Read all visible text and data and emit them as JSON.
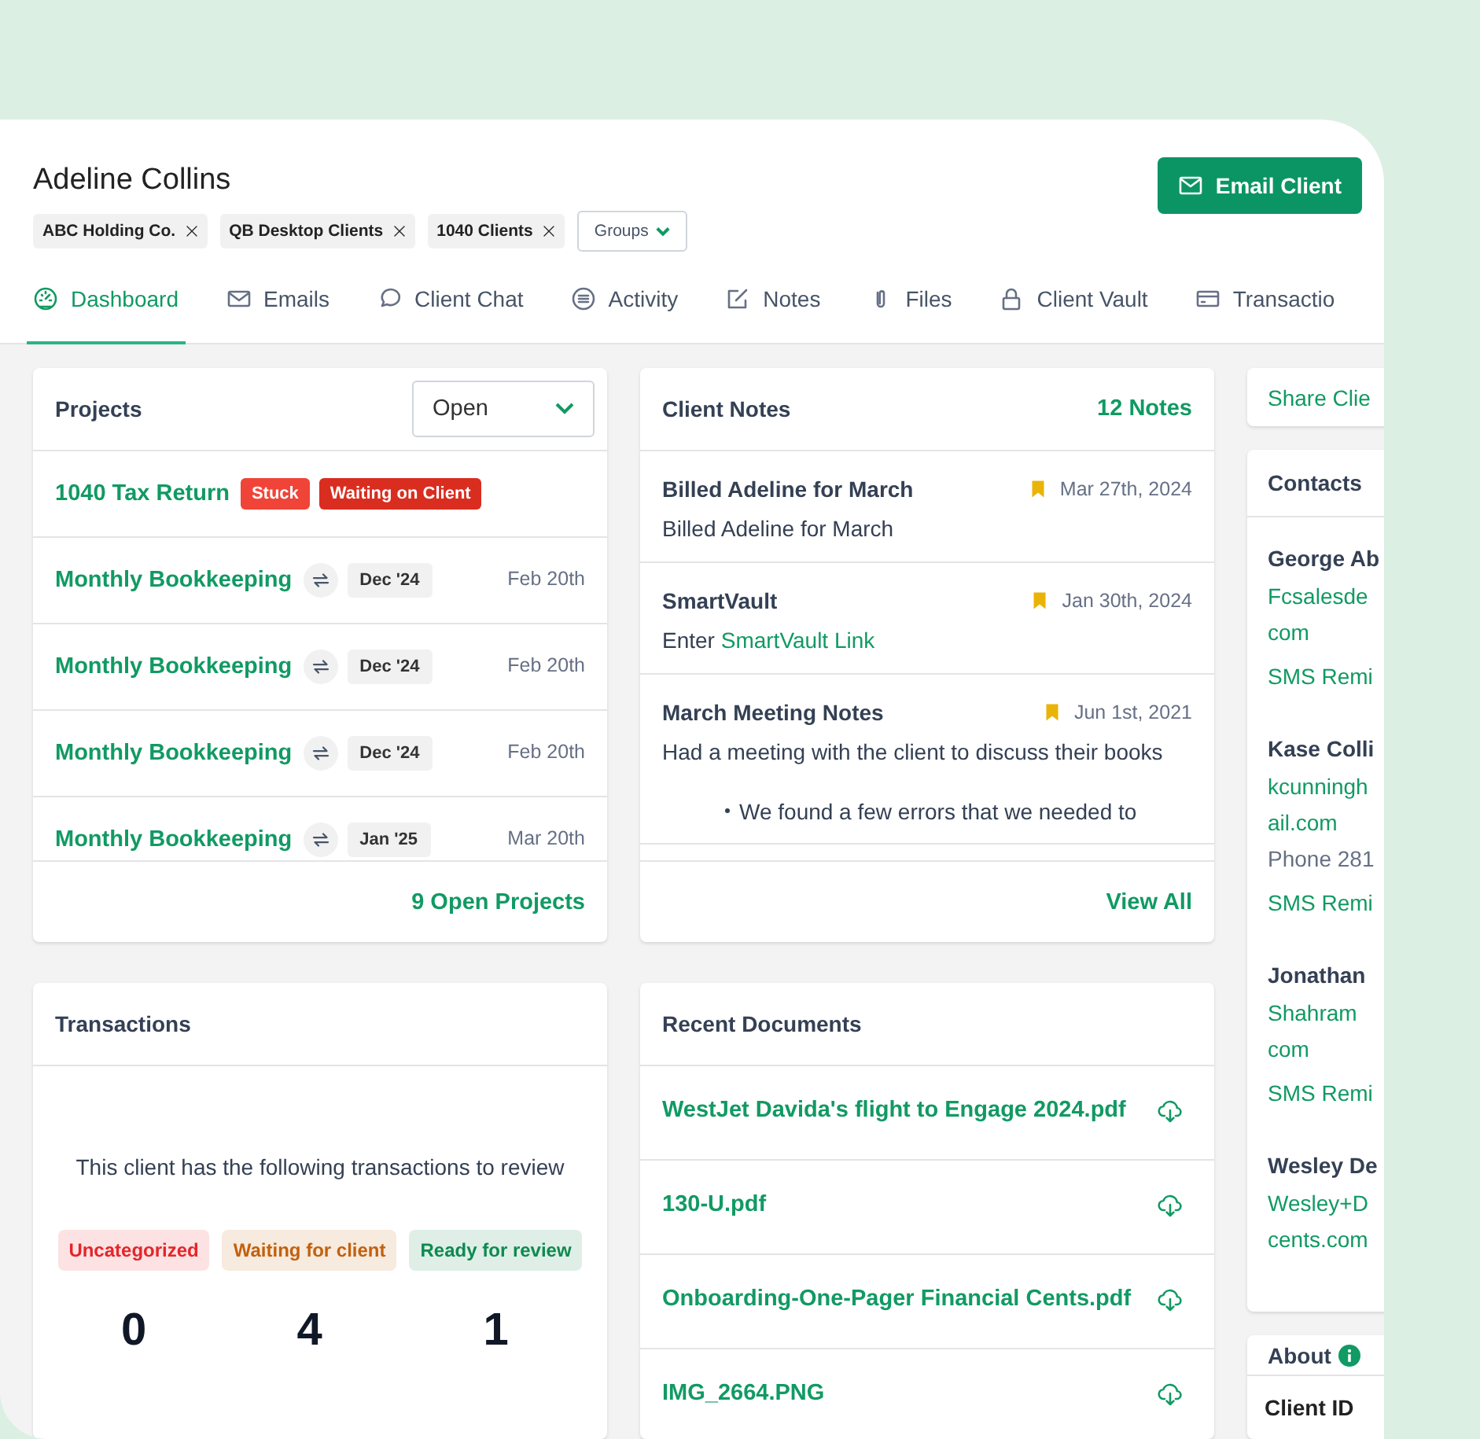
{
  "client": {
    "name": "Adeline Collins",
    "groups": [
      {
        "label": "ABC Holding Co."
      },
      {
        "label": "QB Desktop Clients"
      },
      {
        "label": "1040 Clients"
      }
    ],
    "groups_button": "Groups",
    "email_button": "Email Client"
  },
  "tabs": [
    {
      "label": "Dashboard",
      "selected": true
    },
    {
      "label": "Emails",
      "selected": false
    },
    {
      "label": "Client Chat",
      "selected": false
    },
    {
      "label": "Activity",
      "selected": false
    },
    {
      "label": "Notes",
      "selected": false
    },
    {
      "label": "Files",
      "selected": false
    },
    {
      "label": "Client Vault",
      "selected": false
    },
    {
      "label": "Transactio",
      "selected": false
    }
  ],
  "projects": {
    "title": "Projects",
    "filter": "Open",
    "rows": [
      {
        "kind": "tagged",
        "name": "1040 Tax Return",
        "tags": [
          {
            "label": "Stuck",
            "color": "#f04438"
          },
          {
            "label": "Waiting on Client",
            "color": "#d92d20"
          }
        ]
      },
      {
        "kind": "recurring",
        "name": "Monthly Bookkeeping",
        "period": "Dec '24",
        "date": "Feb 20th"
      },
      {
        "kind": "recurring",
        "name": "Monthly Bookkeeping",
        "period": "Dec '24",
        "date": "Feb 20th"
      },
      {
        "kind": "recurring",
        "name": "Monthly Bookkeeping",
        "period": "Dec '24",
        "date": "Feb 20th"
      },
      {
        "kind": "recurring",
        "name": "Monthly Bookkeeping",
        "period": "Jan '25",
        "date": "Mar 20th"
      }
    ],
    "footer": "9 Open Projects"
  },
  "client_notes": {
    "title": "Client Notes",
    "count": "12 Notes",
    "notes": [
      {
        "title": "Billed Adeline for March",
        "date": "Mar 27th, 2024",
        "body": "Billed Adeline for March"
      },
      {
        "title": "SmartVault",
        "date": "Jan 30th, 2024",
        "body": "Enter",
        "link": "SmartVault Link"
      },
      {
        "title": "March Meeting Notes",
        "date": "Jun 1st, 2021",
        "body": "Had a meeting with the client to discuss their books",
        "bullets": [
          "We found a few errors that we needed to"
        ]
      }
    ],
    "footer": "View All"
  },
  "transactions": {
    "title": "Transactions",
    "message": "This client has the following transactions to review",
    "statuses": [
      {
        "label": "Uncategorized",
        "count": "0",
        "color": "#e5252a"
      },
      {
        "label": "Waiting for client",
        "count": "4",
        "color": "#c2610c"
      },
      {
        "label": "Ready for review",
        "count": "1",
        "color": "#0f8a4f"
      }
    ]
  },
  "recent_documents": {
    "title": "Recent Documents",
    "files": [
      {
        "name": "WestJet Davida's flight to Engage 2024.pdf"
      },
      {
        "name": "130-U.pdf"
      },
      {
        "name": "Onboarding-One-Pager Financial Cents.pdf"
      },
      {
        "name": "IMG_2664.PNG"
      }
    ]
  },
  "share_client": "Share Clie",
  "contacts": {
    "title": "Contacts",
    "people": [
      {
        "name": "George Ab",
        "email_lines": [
          "Fcsalesde",
          "com"
        ],
        "sms": "SMS Remi"
      },
      {
        "name": "Kase Colli",
        "email_lines": [
          "kcunningh",
          "ail.com"
        ],
        "phone": "Phone 281",
        "sms": "SMS Remi"
      },
      {
        "name": "Jonathan",
        "email_lines": [
          "Shahram",
          "com"
        ],
        "sms": "SMS Remi"
      },
      {
        "name": "Wesley De",
        "email_lines": [
          "Wesley+D",
          "cents.com"
        ]
      }
    ]
  },
  "about": {
    "title": "About",
    "client_id_label": "Client ID"
  }
}
